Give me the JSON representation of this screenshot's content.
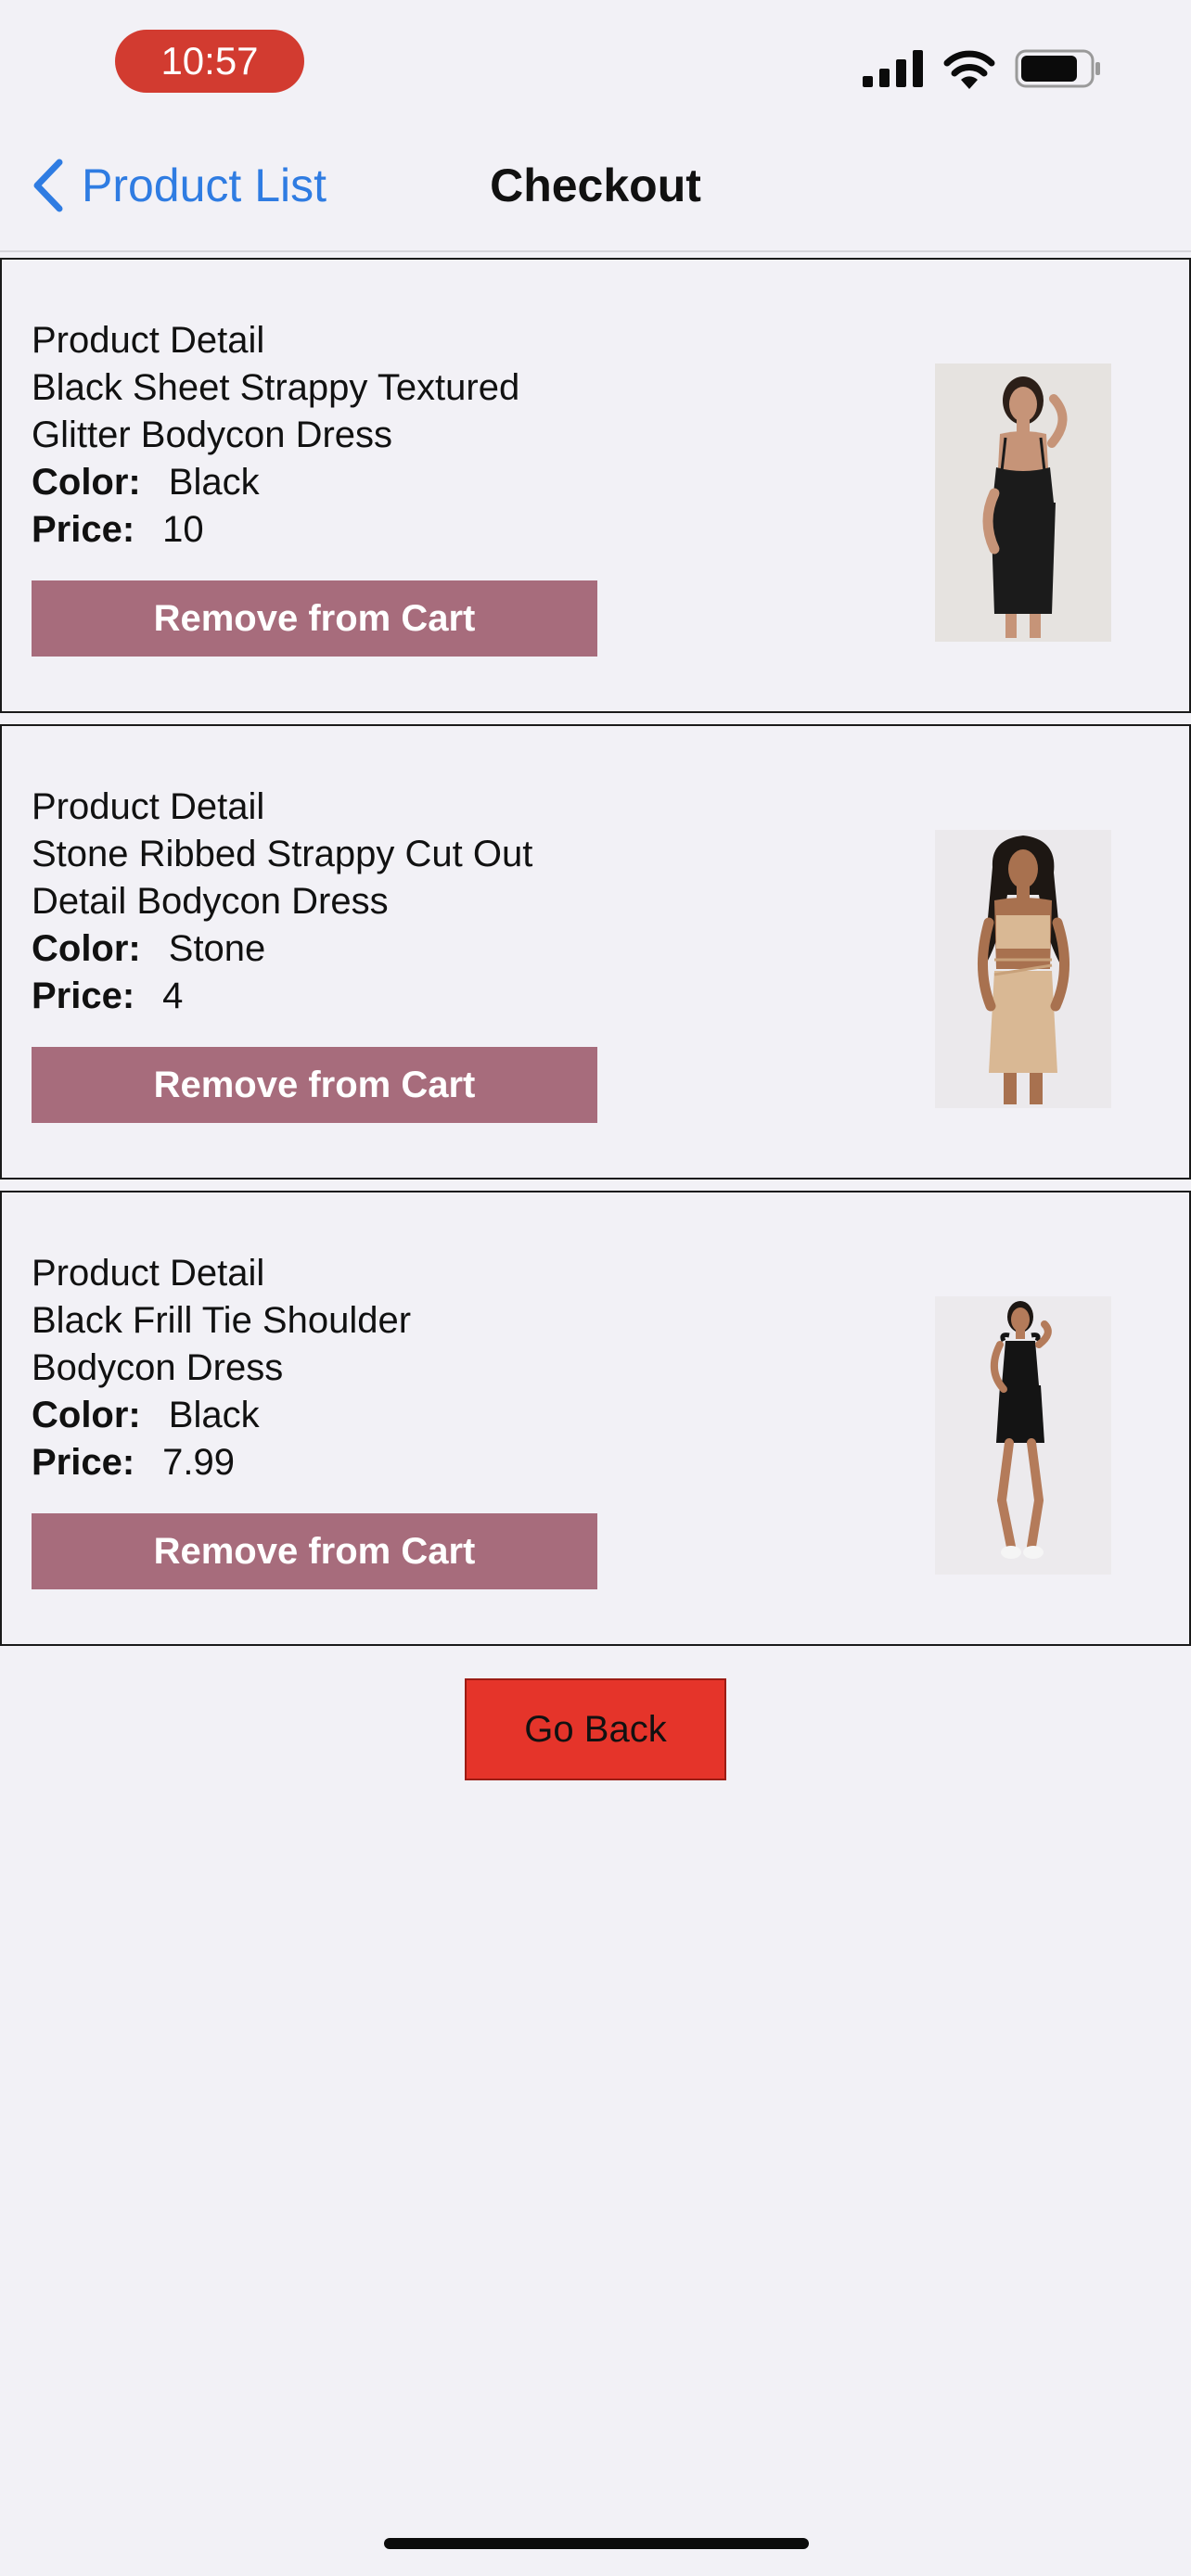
{
  "status_bar": {
    "time": "10:57",
    "icons": [
      "signal-icon",
      "wifi-icon",
      "battery-icon"
    ],
    "time_pill_color": "#d23b30"
  },
  "nav": {
    "back_label": "Product List",
    "title": "Checkout",
    "back_color": "#2f7ce2"
  },
  "cart": {
    "detail_heading": "Product Detail",
    "color_label": "Color:",
    "price_label": "Price:",
    "remove_label": "Remove from Cart",
    "remove_color": "#a76c7c",
    "items": [
      {
        "name_line1": "Black Sheet Strappy Textured",
        "name_line2": "Glitter Bodycon Dress",
        "color": "Black",
        "price": "10",
        "image": "black-strappy-dress-photo"
      },
      {
        "name_line1": "Stone Ribbed Strappy Cut Out",
        "name_line2": "Detail Bodycon Dress",
        "color": "Stone",
        "price": "4",
        "image": "stone-cutout-dress-photo"
      },
      {
        "name_line1": "Black Frill Tie Shoulder",
        "name_line2": "Bodycon Dress",
        "color": "Black",
        "price": "7.99",
        "image": "black-frill-dress-photo"
      }
    ]
  },
  "footer": {
    "go_back_label": "Go Back",
    "go_back_color": "#e5342a"
  }
}
